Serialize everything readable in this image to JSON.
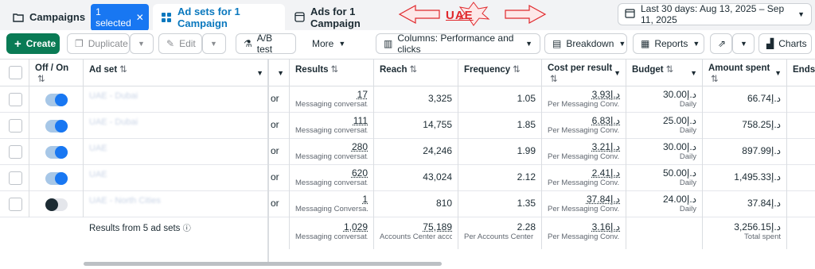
{
  "tabs": {
    "campaigns": "Campaigns",
    "selected_pill": "1 selected",
    "adsets": "Ad sets for 1 Campaign",
    "ads": "Ads for 1 Campaign"
  },
  "annotation": {
    "text": "UAE",
    "color": "#e0282c"
  },
  "date_range": "Last 30 days: Aug 13, 2025 – Sep 11, 2025",
  "toolbar": {
    "create": "Create",
    "duplicate": "Duplicate",
    "edit": "Edit",
    "ab_test": "A/B test",
    "more": "More",
    "columns": "Columns: Performance and clicks",
    "breakdown": "Breakdown",
    "reports": "Reports",
    "charts": "Charts"
  },
  "headers": {
    "off_on": "Off / On",
    "adset": "Ad set",
    "results": "Results",
    "reach": "Reach",
    "frequency": "Frequency",
    "cost_per_result": "Cost per result",
    "budget": "Budget",
    "amount_spent": "Amount spent",
    "ends": "Ends"
  },
  "rows": [
    {
      "on": true,
      "name": "UAE - Dubai",
      "c3": "or",
      "results": "17",
      "results_sub": "Messaging conversat...",
      "reach": "3,325",
      "frequency": "1.05",
      "cpr": "3.93د.إ",
      "cpr_sub": "Per Messaging Conv...",
      "budget": "30.00د.إ",
      "budget_sub": "Daily",
      "spent": "66.74د.إ"
    },
    {
      "on": true,
      "name": "UAE - Dubai",
      "c3": "or",
      "results": "111",
      "results_sub": "Messaging conversat...",
      "reach": "14,755",
      "frequency": "1.85",
      "cpr": "6.83د.إ",
      "cpr_sub": "Per Messaging Conv...",
      "budget": "25.00د.إ",
      "budget_sub": "Daily",
      "spent": "758.25د.إ"
    },
    {
      "on": true,
      "name": "UAE",
      "c3": "or",
      "results": "280",
      "results_sub": "Messaging conversat...",
      "reach": "24,246",
      "frequency": "1.99",
      "cpr": "3.21د.إ",
      "cpr_sub": "Per Messaging Conv...",
      "budget": "30.00د.إ",
      "budget_sub": "Daily",
      "spent": "897.99د.إ"
    },
    {
      "on": true,
      "name": "UAE",
      "c3": "or",
      "results": "620",
      "results_sub": "Messaging conversat...",
      "reach": "43,024",
      "frequency": "2.12",
      "cpr": "2.41د.إ",
      "cpr_sub": "Per Messaging Conv...",
      "budget": "50.00د.إ",
      "budget_sub": "Daily",
      "spent": "1,495.33د.إ"
    },
    {
      "on": false,
      "name": "UAE - North Cities",
      "c3": "or",
      "results": "1",
      "results_sub": "Messaging Conversa...",
      "reach": "810",
      "frequency": "1.35",
      "cpr": "37.84د.إ",
      "cpr_sub": "Per Messaging Conv...",
      "budget": "24.00د.إ",
      "budget_sub": "Daily",
      "spent": "37.84د.إ"
    }
  ],
  "summary": {
    "label": "Results from 5 ad sets",
    "results": "1,029",
    "results_sub": "Messaging conversat...",
    "reach": "75,189",
    "reach_sub": "Accounts Center acco...",
    "frequency": "2.28",
    "frequency_sub": "Per Accounts Center ...",
    "cpr": "3.16د.إ",
    "cpr_sub": "Per Messaging Conv...",
    "spent": "3,256.15د.إ",
    "spent_sub": "Total spent"
  }
}
